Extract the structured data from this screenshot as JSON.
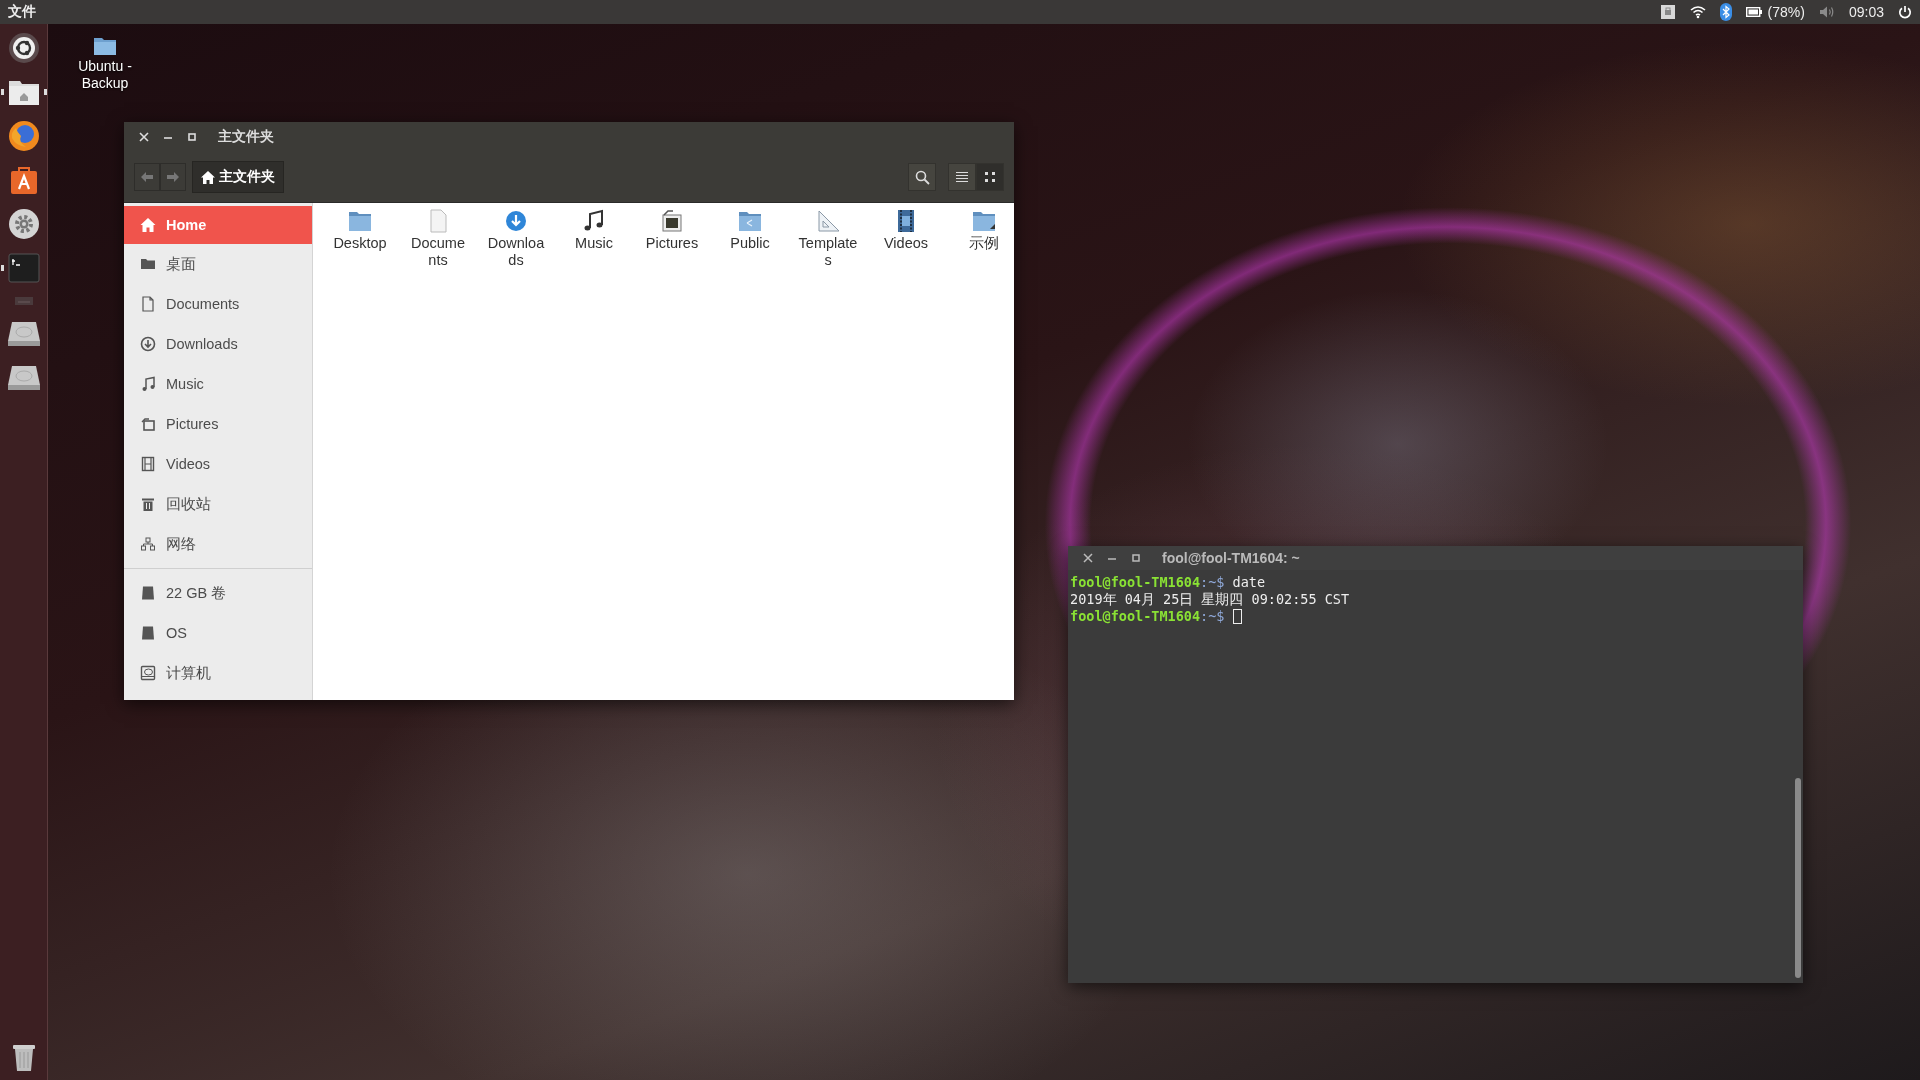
{
  "top_bar": {
    "app_menu": "文件",
    "indicators": [
      {
        "kind": "keyboard"
      },
      {
        "kind": "wifi"
      },
      {
        "kind": "bluetooth"
      },
      {
        "kind": "battery",
        "text": "(78%)"
      },
      {
        "kind": "volume"
      },
      {
        "kind": "clock",
        "text": "09:03"
      },
      {
        "kind": "power"
      }
    ]
  },
  "launcher": [
    {
      "kind": "dash",
      "running": false,
      "focused": false
    },
    {
      "kind": "files",
      "running": true,
      "focused": true
    },
    {
      "kind": "browser",
      "running": false,
      "focused": false
    },
    {
      "kind": "software",
      "running": false,
      "focused": false
    },
    {
      "kind": "settings",
      "running": false,
      "focused": false
    },
    {
      "kind": "terminal",
      "running": true,
      "focused": false
    },
    {
      "kind": "faded",
      "running": false,
      "focused": false
    },
    {
      "kind": "drive",
      "running": false,
      "focused": false
    },
    {
      "kind": "drive",
      "running": false,
      "focused": false
    }
  ],
  "trash": {
    "kind": "trash"
  },
  "desktop_icons": [
    {
      "label": "Ubuntu - Backup"
    }
  ],
  "file_manager": {
    "title": "主文件夹",
    "path_button": "主文件夹",
    "view_buttons": [
      {
        "kind": "list",
        "selected": false
      },
      {
        "kind": "grid",
        "selected": true
      }
    ],
    "sidebar": [
      {
        "items": [
          {
            "kind": "home",
            "label": "Home",
            "selected": true
          },
          {
            "kind": "folder",
            "label": "桌面",
            "selected": false
          },
          {
            "kind": "document",
            "label": "Documents",
            "selected": false
          },
          {
            "kind": "download",
            "label": "Downloads",
            "selected": false
          },
          {
            "kind": "music",
            "label": "Music",
            "selected": false
          },
          {
            "kind": "pictures",
            "label": "Pictures",
            "selected": false
          },
          {
            "kind": "videos",
            "label": "Videos",
            "selected": false
          },
          {
            "kind": "trash",
            "label": "回收站",
            "selected": false
          },
          {
            "kind": "network",
            "label": "网络",
            "selected": false
          }
        ]
      },
      {
        "items": [
          {
            "kind": "drive",
            "label": "22 GB 卷",
            "selected": false
          },
          {
            "kind": "drive",
            "label": "OS",
            "selected": false
          },
          {
            "kind": "computer",
            "label": "计算机",
            "selected": false
          }
        ]
      }
    ],
    "files": [
      {
        "kind": "folder",
        "name": "Desktop"
      },
      {
        "kind": "document",
        "name": "Documents"
      },
      {
        "kind": "download",
        "name": "Downloads"
      },
      {
        "kind": "music",
        "name": "Music"
      },
      {
        "kind": "pictures",
        "name": "Pictures"
      },
      {
        "kind": "public",
        "name": "Public"
      },
      {
        "kind": "templates",
        "name": "Templates"
      },
      {
        "kind": "videos",
        "name": "Videos"
      },
      {
        "kind": "example",
        "name": "示例"
      }
    ]
  },
  "terminal": {
    "title": "fool@fool-TM1604: ~",
    "lines": [
      {
        "kind": "prompt",
        "user": "fool@fool-TM1604",
        "path": ":~$",
        "command": "date",
        "cursor": false
      },
      {
        "kind": "output",
        "text": "2019年 04月 25日 星期四 09:02:55 CST"
      },
      {
        "kind": "prompt",
        "user": "fool@fool-TM1604",
        "path": ":~$",
        "cursor": true
      }
    ]
  }
}
